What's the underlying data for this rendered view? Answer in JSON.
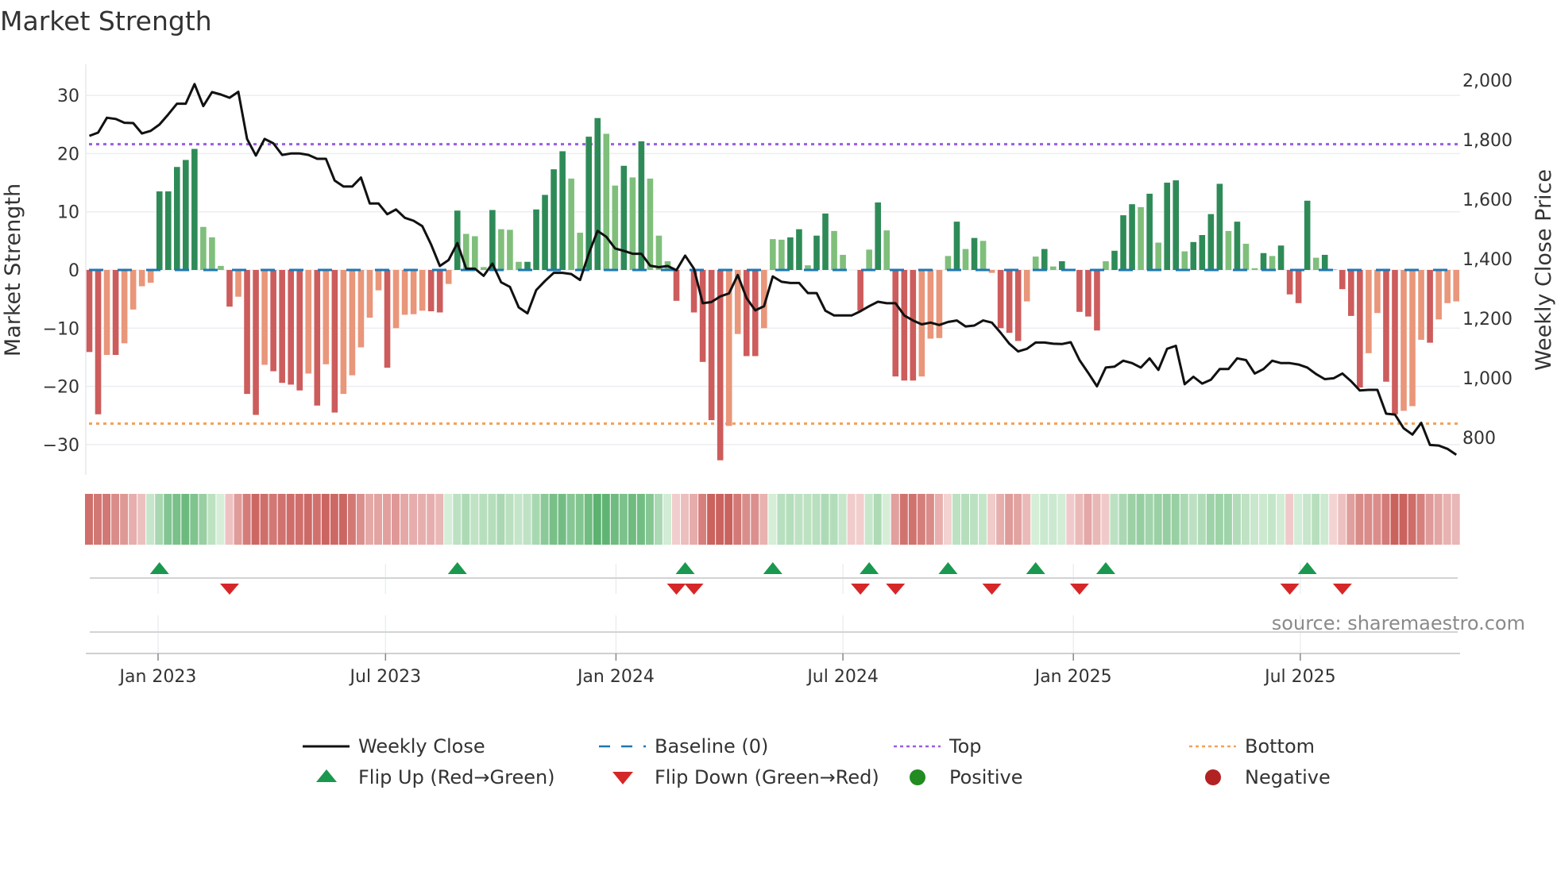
{
  "chart_data": {
    "type": "bar",
    "title": "Market Strength",
    "ylabel": "Market Strength",
    "y2label": "Weekly Close Price",
    "ylim": [
      -35,
      35
    ],
    "y2lim": [
      730,
      2050
    ],
    "yticks": [
      30,
      20,
      10,
      0,
      -10,
      -20,
      -30
    ],
    "yticklabels": [
      "30",
      "20",
      "10",
      "0",
      "−10",
      "−20",
      "−30"
    ],
    "y2ticks": [
      2000,
      1800,
      1600,
      1400,
      1200,
      1000,
      800
    ],
    "y2ticklabels": [
      "2,000",
      "1,800",
      "1,600",
      "1,400",
      "1,200",
      "1,000",
      "800"
    ],
    "x_unit": "week index",
    "xticks": [
      7.84,
      33.8,
      60.1,
      86.0,
      112.3,
      138.2
    ],
    "xticklabels": [
      "Jan 2023",
      "Jul 2023",
      "Jan 2024",
      "Jul 2024",
      "Jan 2025",
      "Jul 2025"
    ],
    "top_level": 21.6,
    "bottom_level": -26.4,
    "baseline": 0,
    "grid": true,
    "legend_position": "bottom-center",
    "series": [
      {
        "name": "Market Strength",
        "type": "bar",
        "values": [
          -14.1,
          -24.8,
          -14.6,
          -14.6,
          -12.6,
          -6.8,
          -2.8,
          -2.2,
          13.5,
          13.5,
          17.7,
          18.9,
          20.8,
          7.4,
          5.6,
          0.7,
          -6.3,
          -4.6,
          -21.3,
          -24.9,
          -16.3,
          -17.4,
          -19.4,
          -19.7,
          -20.7,
          -17.8,
          -23.3,
          -16.2,
          -24.5,
          -21.3,
          -18.1,
          -13.3,
          -8.2,
          -3.5,
          -16.8,
          -10.0,
          -7.7,
          -7.6,
          -7.0,
          -7.1,
          -7.3,
          -2.4,
          10.2,
          6.2,
          5.8,
          0.5,
          10.3,
          7.0,
          6.9,
          1.4,
          1.4,
          10.4,
          12.9,
          17.3,
          20.4,
          15.7,
          6.4,
          22.9,
          26.1,
          23.4,
          14.5,
          17.9,
          15.9,
          22.1,
          15.7,
          5.9,
          1.5,
          -5.3,
          0,
          -7.3,
          -15.8,
          -25.8,
          -32.7,
          -26.8,
          -11.0,
          -14.8,
          -14.8,
          -10.0,
          5.3,
          5.2,
          5.6,
          7.0,
          0.8,
          5.9,
          9.7,
          6.7,
          2.6,
          0,
          -7.0,
          3.5,
          11.6,
          6.8,
          -18.3,
          -19.0,
          -19.0,
          -18.3,
          -11.8,
          -11.7,
          2.4,
          8.3,
          3.6,
          5.5,
          5.0,
          -0.5,
          -10.0,
          -10.8,
          -12.2,
          -5.4,
          2.3,
          3.6,
          0.6,
          1.5,
          0,
          -7.2,
          -8.0,
          -10.4,
          1.5,
          3.3,
          9.4,
          11.3,
          10.8,
          13.1,
          4.7,
          15.0,
          15.4,
          3.2,
          4.8,
          6.0,
          9.6,
          14.8,
          6.7,
          8.3,
          4.5,
          0.3,
          2.9,
          2.4,
          4.2,
          -4.2,
          -5.7,
          11.9,
          2.1,
          2.6,
          0.1,
          -3.3,
          -7.9,
          -20.2,
          -14.3,
          -7.4,
          -19.2,
          -24.8,
          -24.2,
          -23.4,
          -12.0,
          -12.5,
          -8.5,
          -5.7,
          -5.4
        ]
      },
      {
        "name": "Weekly Close",
        "type": "line",
        "axis": "right",
        "values": [
          1813,
          1824,
          1874,
          1870,
          1857,
          1856,
          1821,
          1830,
          1851,
          1885,
          1921,
          1921,
          1987,
          1913,
          1960,
          1952,
          1941,
          1961,
          1803,
          1747,
          1803,
          1788,
          1749,
          1754,
          1754,
          1749,
          1736,
          1736,
          1663,
          1643,
          1643,
          1673,
          1586,
          1586,
          1550,
          1566,
          1538,
          1528,
          1510,
          1448,
          1376,
          1396,
          1453,
          1367,
          1367,
          1343,
          1384,
          1321,
          1306,
          1237,
          1217,
          1295,
          1326,
          1353,
          1353,
          1349,
          1329,
          1418,
          1494,
          1474,
          1435,
          1427,
          1417,
          1417,
          1377,
          1372,
          1376,
          1362,
          1411,
          1367,
          1251,
          1255,
          1274,
          1284,
          1346,
          1268,
          1227,
          1241,
          1341,
          1323,
          1319,
          1319,
          1285,
          1285,
          1226,
          1210,
          1210,
          1210,
          1224,
          1241,
          1256,
          1251,
          1251,
          1210,
          1193,
          1180,
          1186,
          1178,
          1188,
          1193,
          1173,
          1176,
          1193,
          1186,
          1152,
          1115,
          1089,
          1098,
          1119,
          1119,
          1115,
          1114,
          1120,
          1060,
          1017,
          972,
          1035,
          1038,
          1058,
          1050,
          1035,
          1066,
          1027,
          1098,
          1108,
          979,
          1004,
          981,
          994,
          1030,
          1030,
          1066,
          1060,
          1015,
          1030,
          1058,
          1050,
          1050,
          1045,
          1035,
          1013,
          996,
          999,
          1015,
          989,
          958,
          960,
          960,
          880,
          877,
          831,
          810,
          849,
          775,
          773,
          762,
          742
        ]
      }
    ],
    "flips_up": [
      8,
      42,
      68,
      78,
      89,
      98,
      108,
      116,
      139
    ],
    "flips_down": [
      16,
      67,
      69,
      88,
      92,
      103,
      113,
      137,
      143
    ],
    "legend": [
      {
        "label": "Weekly Close",
        "symbol": "line"
      },
      {
        "label": "Baseline (0)",
        "symbol": "dash"
      },
      {
        "label": "Top",
        "symbol": "dot-purple"
      },
      {
        "label": "Bottom",
        "symbol": "dot-orange"
      },
      {
        "label": "Flip Up (Red→Green)",
        "symbol": "triangle-up"
      },
      {
        "label": "Flip Down (Green→Red)",
        "symbol": "triangle-down"
      },
      {
        "label": "Positive",
        "symbol": "circle-green"
      },
      {
        "label": "Negative",
        "symbol": "circle-red"
      }
    ],
    "source": "source: sharemaestro.com",
    "colors": {
      "pos_strong": "#2e8b57",
      "pos_weak": "#7fbf7b",
      "neg_strong": "#cd5c5c",
      "neg_weak": "#e9967a",
      "line": "#111111",
      "baseline": "#1f77b4",
      "top": "#9b5de5",
      "bottom": "#f4a259",
      "flip_up": "#1a9850",
      "flip_down": "#d62728",
      "positive": "#228b22",
      "negative": "#b22222"
    }
  }
}
